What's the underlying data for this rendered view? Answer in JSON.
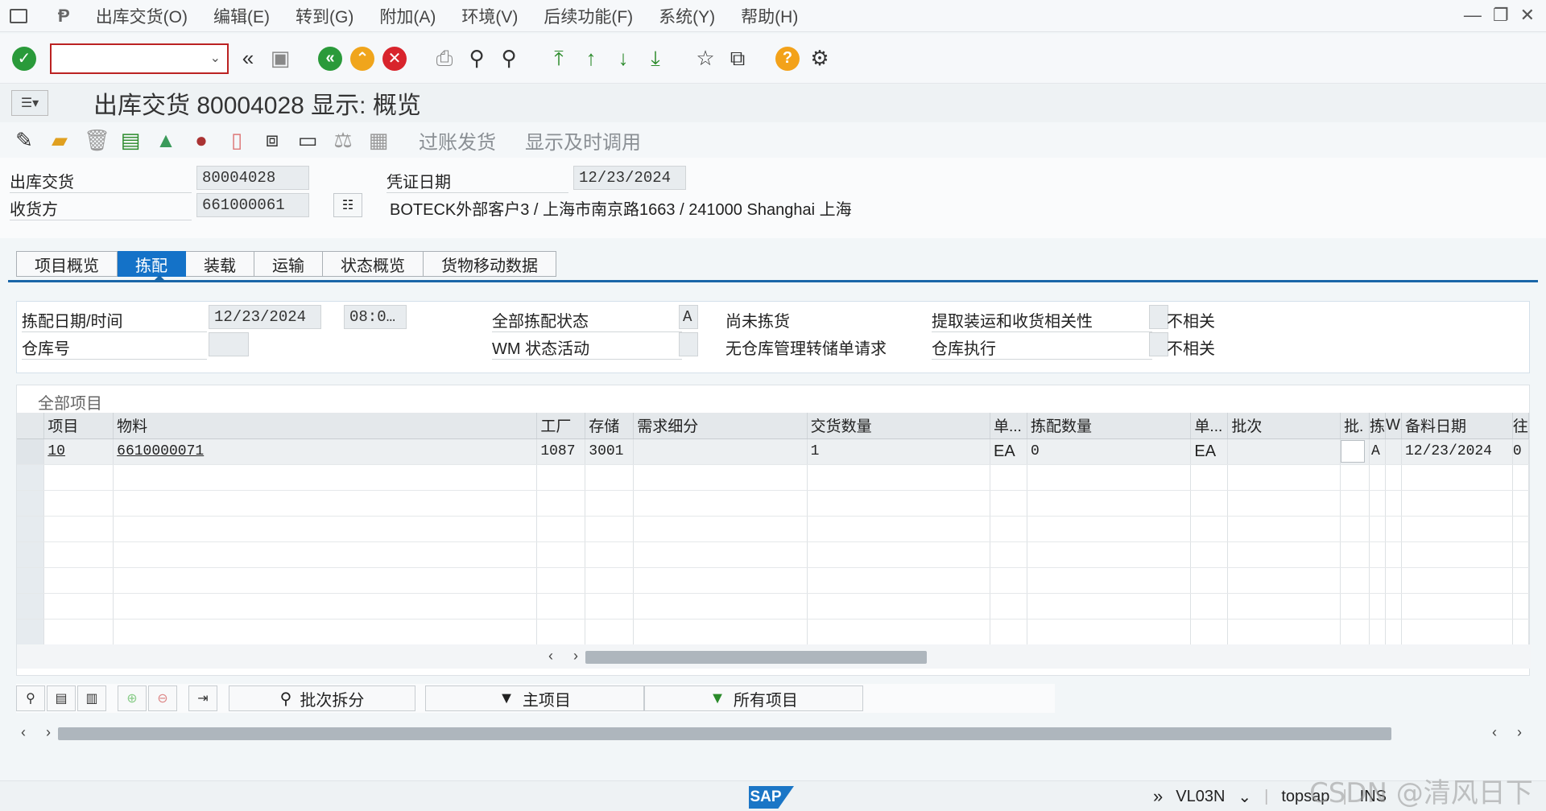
{
  "menu": {
    "items": [
      "出库交货(O)",
      "编辑(E)",
      "转到(G)",
      "附加(A)",
      "环境(V)",
      "后续功能(F)",
      "系统(Y)",
      "帮助(H)"
    ]
  },
  "toolbar": {
    "command_value": "",
    "icons": [
      "check-icon",
      "back-double-icon",
      "save-icon",
      "back-icon",
      "exit-icon",
      "cancel-icon",
      "print-icon",
      "find-icon",
      "find-next-icon",
      "first-page-icon",
      "prev-page-icon",
      "next-page-icon",
      "last-page-icon",
      "create-session-icon",
      "shortcut-icon",
      "help-icon",
      "settings-icon"
    ]
  },
  "title": "出库交货 80004028 显示: 概览",
  "app_toolbar": {
    "post_goods_issue": "过账发货",
    "display_timely_call": "显示及时调用"
  },
  "header": {
    "delivery_label": "出库交货",
    "delivery_value": "80004028",
    "ship_to_label": "收货方",
    "ship_to_value": "661000061",
    "doc_date_label": "凭证日期",
    "doc_date_value": "12/23/2024",
    "address": "BOTECK外部客户3 / 上海市南京路1663 / 241000 Shanghai 上海"
  },
  "tabs": [
    "项目概览",
    "拣配",
    "装载",
    "运输",
    "状态概览",
    "货物移动数据"
  ],
  "active_tab": "拣配",
  "picking": {
    "date_time_label": "拣配日期/时间",
    "date_value": "12/23/2024",
    "time_value": "08:0…",
    "warehouse_label": "仓库号",
    "warehouse_value": "",
    "overall_status_label": "全部拣配状态",
    "overall_status_value": "A",
    "overall_status_text": "尚未拣货",
    "wm_activity_label": "WM 状态活动",
    "wm_activity_value": "",
    "wm_activity_text": "无仓库管理转储单请求",
    "relevance_label": "提取装运和收货相关性",
    "relevance_value": "不相关",
    "warehouse_exec_label": "仓库执行",
    "warehouse_exec_value": "不相关"
  },
  "items_table": {
    "title": "全部项目",
    "columns": [
      "项目",
      "物料",
      "工厂",
      "存储",
      "需求细分",
      "交货数量",
      "单...",
      "拣配数量",
      "单...",
      "批次",
      "批.",
      "拣",
      "W",
      "备料日期",
      "往"
    ],
    "rows": [
      [
        "10",
        "6610000071",
        "1087",
        "3001",
        "",
        "1",
        "EA",
        "0",
        "EA",
        "",
        "",
        "A",
        "",
        "12/23/2024",
        "0"
      ]
    ]
  },
  "bottom_buttons": {
    "batch_split": "批次拆分",
    "main_items": "主项目",
    "all_items": "所有项目"
  },
  "status": {
    "transaction": "VL03N",
    "system": "topsap",
    "mode": "INS"
  },
  "watermark": "CSDN @清风日下",
  "colors": {
    "active_tab": "#1472c8",
    "check_green": "#2a9a3a",
    "exit_orange": "#f0a51c",
    "cancel_red": "#d8242c",
    "help_orange": "#f3a21a",
    "sap_blue": "#1b76c6"
  }
}
